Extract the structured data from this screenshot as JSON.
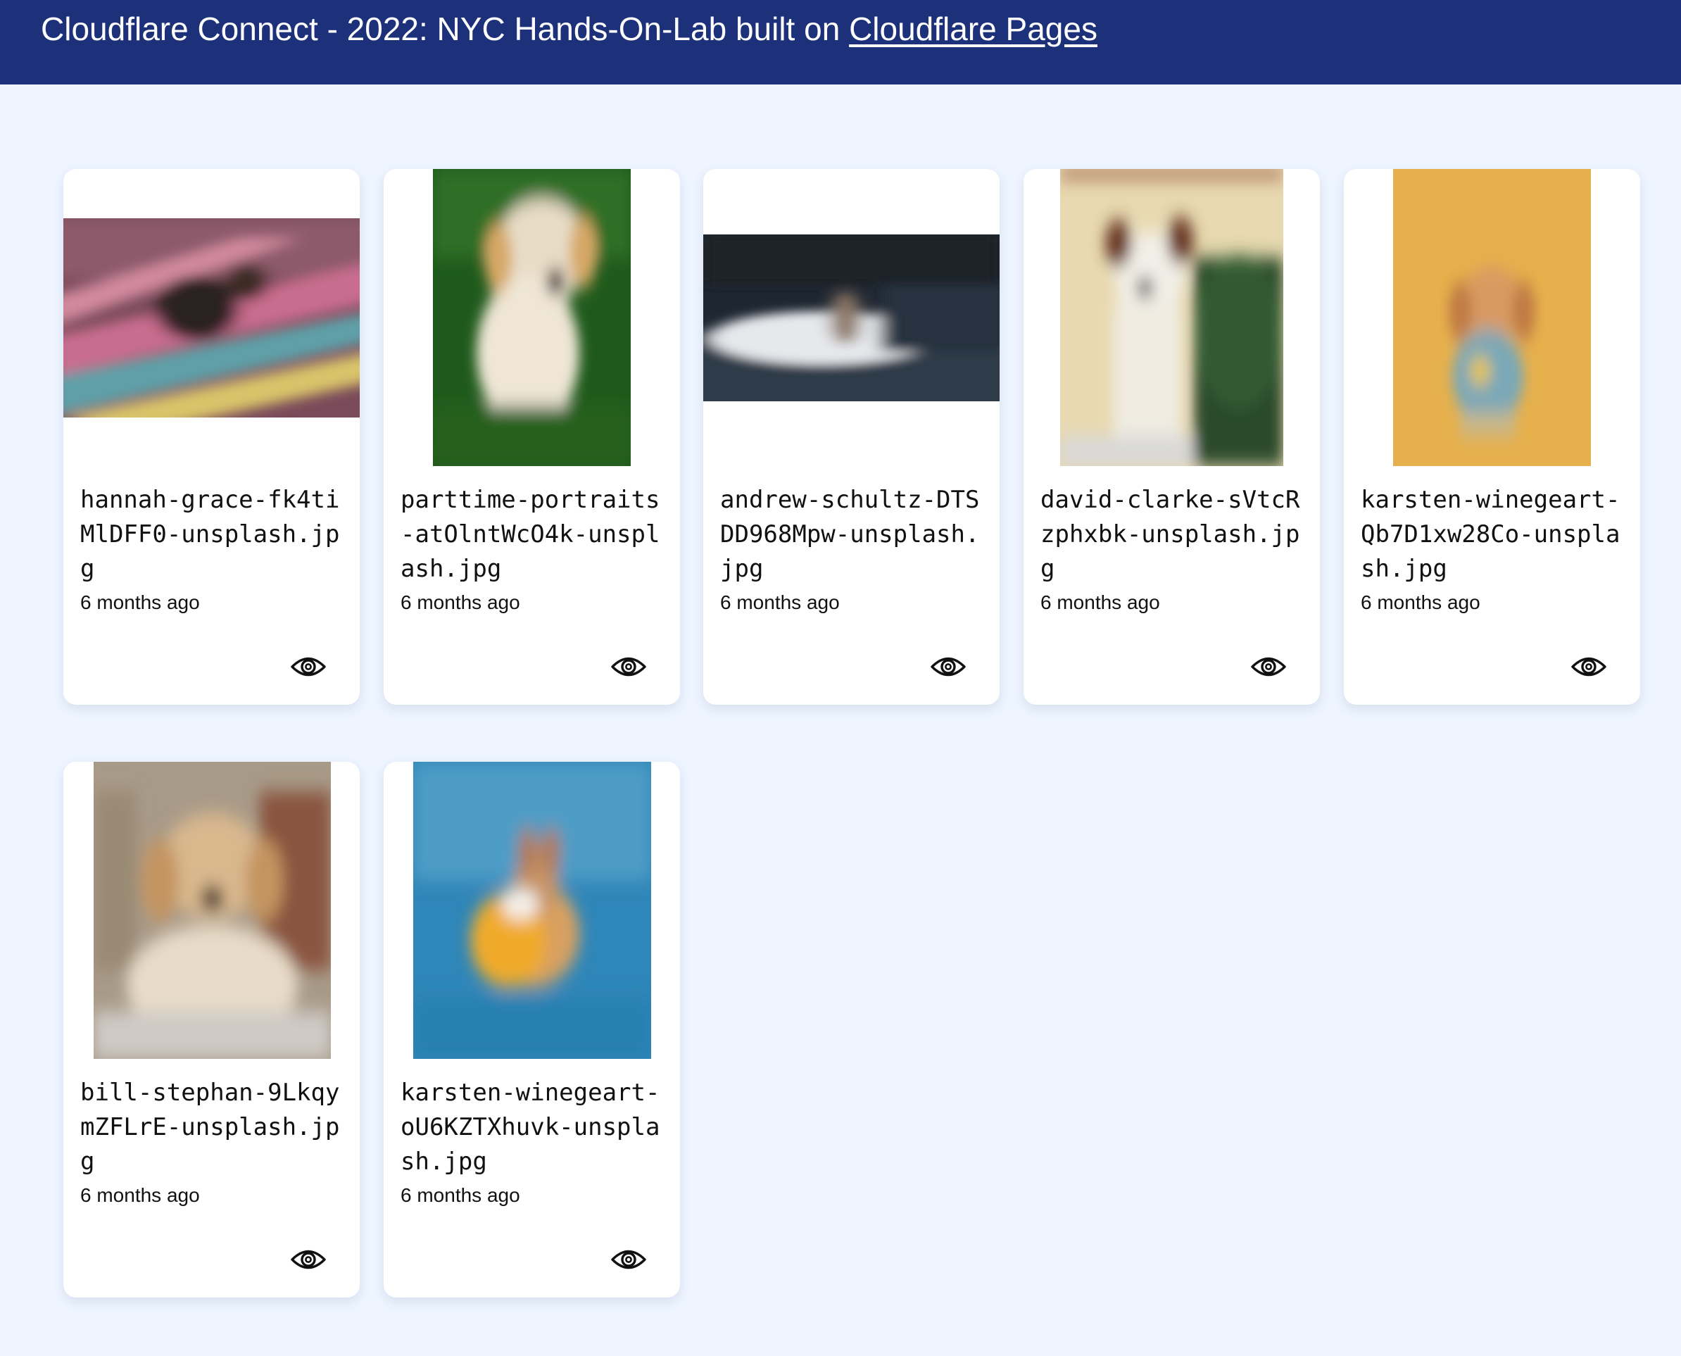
{
  "header": {
    "title_prefix": "Cloudflare Connect - 2022: NYC Hands-On-Lab built on ",
    "link_text": "Cloudflare Pages"
  },
  "colors": {
    "header_bg": "#1c317a",
    "page_bg": "#eef5ff",
    "card_bg": "#ffffff"
  },
  "cards": [
    {
      "filename": "hannah-grace-fk4tiMlDFF0-unsplash.jpg",
      "time": "6 months ago",
      "icon": "eye-icon"
    },
    {
      "filename": "parttime-portraits-atOlntWcO4k-unsplash.jpg",
      "time": "6 months ago",
      "icon": "eye-icon"
    },
    {
      "filename": "andrew-schultz-DTSDD968Mpw-unsplash.jpg",
      "time": "6 months ago",
      "icon": "eye-icon"
    },
    {
      "filename": "david-clarke-sVtcRzphxbk-unsplash.jpg",
      "time": "6 months ago",
      "icon": "eye-icon"
    },
    {
      "filename": "karsten-winegeart-Qb7D1xw28Co-unsplash.jpg",
      "time": "6 months ago",
      "icon": "eye-icon"
    },
    {
      "filename": "bill-stephan-9LkqymZFLrE-unsplash.jpg",
      "time": "6 months ago",
      "icon": "eye-icon"
    },
    {
      "filename": "karsten-winegeart-oU6KZTXhuvk-unsplash.jpg",
      "time": "6 months ago",
      "icon": "eye-icon"
    }
  ]
}
